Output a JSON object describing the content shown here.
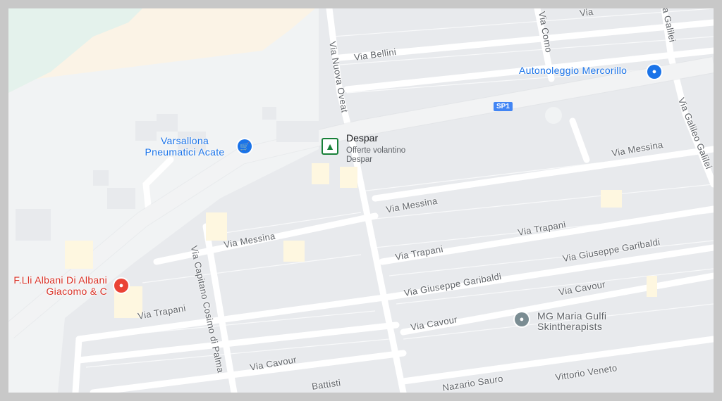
{
  "map": {
    "road_shield": "SP1",
    "streets": {
      "bellini": "Via Bellini",
      "como": "Via Como",
      "nuova_oveat": "Via Nuova Oveat",
      "galilei": "Via Galileo Galilei",
      "galilei_top": "Via Galilei",
      "messina_left": "Via Messina",
      "messina_mid": "Via Messina",
      "messina_right": "Via Messina",
      "capitano": "Via Capitano Cosimo di Palma",
      "trapani_left": "Via Trapani",
      "trapani_mid": "Via Trapani",
      "trapani_right": "Via Trapani",
      "garibaldi_mid": "Via Giuseppe Garibaldi",
      "garibaldi_right": "Via Giuseppe Garibaldi",
      "cavour_left": "Via Cavour",
      "cavour_mid": "Via Cavour",
      "cavour_right": "Via Cavour",
      "battisti": "Battisti",
      "sauro": "Nazario Sauro",
      "veneto": "Vittorio Veneto",
      "top_partial": "Via"
    },
    "pois": {
      "despar": {
        "name": "Despar",
        "subtitle": "Offerte volantino Despar",
        "icon": "tree-icon",
        "color": "#188038"
      },
      "varsallona": {
        "name": "Varsallona Pneumatici Acate",
        "icon": "shopping-bag-icon",
        "color": "#1a73e8"
      },
      "autonoleggio": {
        "name": "Autonoleggio Mercorillo",
        "icon": "car-icon",
        "color": "#1a73e8"
      },
      "albani": {
        "name": "F.Lli Albani Di Albani Giacomo & C",
        "icon": "location-pin-icon",
        "color": "#ea4335"
      },
      "mg_maria": {
        "name": "MG Maria Gulfi Skintherapists",
        "icon": "circle-pin-icon",
        "color": "#7b8d93"
      }
    }
  }
}
